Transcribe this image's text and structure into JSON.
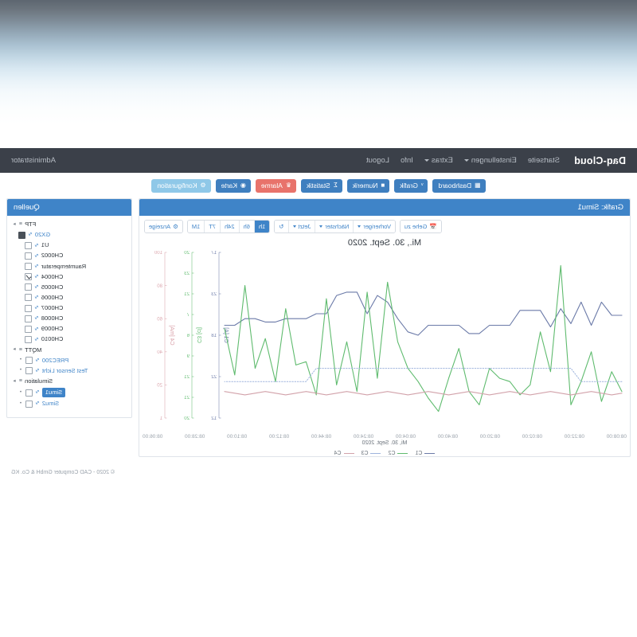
{
  "navbar": {
    "brand": "Daq-Cloud",
    "links": [
      {
        "label": "Startseite",
        "caret": false
      },
      {
        "label": "Einstellungen",
        "caret": true
      },
      {
        "label": "Extras",
        "caret": true
      },
      {
        "label": "Info",
        "caret": false
      },
      {
        "label": "Logout",
        "caret": false
      }
    ],
    "user": "Administrator"
  },
  "toolbar": {
    "buttons": [
      {
        "label": "Dashboard",
        "icon": "grid-icon",
        "glyph": "▦",
        "style": "primary"
      },
      {
        "label": "Grafik",
        "icon": "chart-icon",
        "glyph": "ᵛ",
        "style": "primary"
      },
      {
        "label": "Numerik",
        "icon": "table-icon",
        "glyph": "■",
        "style": "primary"
      },
      {
        "label": "Statistik",
        "icon": "sigma-icon",
        "glyph": "Σ",
        "style": "primary"
      },
      {
        "label": "Alarme",
        "icon": "bell-icon",
        "glyph": "♛",
        "style": "danger"
      },
      {
        "label": "Karte",
        "icon": "globe-icon",
        "glyph": "◉",
        "style": "primary"
      },
      {
        "label": "Konfiguration",
        "icon": "gear-icon",
        "glyph": "⚙",
        "style": "info"
      }
    ]
  },
  "panels": {
    "chart_title": "Grafik: Simu1",
    "sources_title": "Quellen"
  },
  "chart_toolbar": {
    "goto": "Gehe zu",
    "goto_icon": "calendar-icon",
    "prev": "Vorheriger",
    "next": "Nächster",
    "now": "Jetzt",
    "refresh_icon": "refresh-icon",
    "ranges": [
      {
        "label": "1h",
        "active": true
      },
      {
        "label": "6h",
        "active": false
      },
      {
        "label": "24h",
        "active": false
      },
      {
        "label": "7T",
        "active": false
      },
      {
        "label": "1M",
        "active": false
      }
    ],
    "display": "Anzeige",
    "display_icon": "gear-icon"
  },
  "chart_data": {
    "type": "line",
    "title": "Mi., 30. Sept. 2020",
    "xlabel": "Mi, 30. Sept. 2020",
    "grid": false,
    "legend_position": "bottom",
    "x": [
      "08:08:00",
      "08:22:00",
      "08:02:00",
      "08:20:00",
      "08:40:00",
      "08:04:00",
      "08:24:00",
      "08:44:00",
      "08:12:00",
      "08:10:00",
      "08:28:00",
      "08:06:00"
    ],
    "xticks": [
      "08:08:00",
      "08:22:00",
      "08:02:00",
      "08:20:00",
      "08:40:00",
      "08:04:00",
      "08:24:00",
      "08:44:00",
      "08:12:00",
      "08:10:00",
      "08:28:00",
      "08:06:00"
    ],
    "axes": [
      {
        "id": "y1",
        "label": "C1 [A]",
        "color": "#6b7aa8",
        "ticks": [
          "17",
          "23",
          "18",
          "22",
          "12"
        ],
        "ylim": [
          12,
          17
        ]
      },
      {
        "id": "y2",
        "label": "C3 [cl]",
        "color": "#5fbb6e",
        "ticks": [
          "20",
          "23",
          "21",
          "7",
          "6",
          "9",
          "21",
          "21",
          "20"
        ],
        "ylim": [
          20,
          20
        ]
      },
      {
        "id": "y3",
        "label": "C4 [mA]",
        "color": "#d9a0a8",
        "ticks": [
          "100",
          "80",
          "60",
          "40",
          "20",
          "1"
        ],
        "ylim": [
          1,
          100
        ]
      }
    ],
    "series": [
      {
        "name": "C1",
        "color": "#6b7aa8",
        "dash": "solid",
        "axis": "y1",
        "values": [
          62,
          62,
          70,
          56,
          70,
          57,
          66,
          55,
          65,
          65,
          65,
          56,
          56,
          56,
          51,
          51,
          56,
          56,
          56,
          56,
          50,
          52,
          60,
          70,
          74,
          63,
          76,
          76,
          74,
          63,
          63,
          60,
          60,
          60,
          58,
          58,
          60,
          60,
          56,
          56
        ]
      },
      {
        "name": "C2",
        "color": "#5fbb6e",
        "dash": "solid",
        "axis": "y2",
        "values": [
          16,
          28,
          10,
          40,
          22,
          8,
          92,
          28,
          52,
          20,
          14,
          22,
          24,
          30,
          8,
          16,
          42,
          24,
          4,
          12,
          22,
          30,
          46,
          82,
          24,
          76,
          16,
          46,
          20,
          72,
          14,
          34,
          32,
          66,
          22,
          48,
          30,
          80,
          26,
          54
        ]
      },
      {
        "name": "C3",
        "color": "#9fb4dd",
        "dash": "dotted",
        "axis": "y2",
        "values": [
          22,
          22,
          22,
          22,
          22,
          30,
          30,
          30,
          30,
          30,
          30,
          30,
          30,
          30,
          30,
          30,
          30,
          30,
          30,
          30,
          30,
          30,
          30,
          30,
          30,
          30,
          30,
          30,
          30,
          30,
          30,
          22,
          22,
          22,
          22,
          22,
          22,
          22,
          22,
          22
        ]
      },
      {
        "name": "C4",
        "color": "#d2a2aa",
        "dash": "solid",
        "axis": "y3",
        "values": [
          15,
          14,
          15,
          16,
          15,
          14,
          15,
          16,
          15,
          14,
          15,
          16,
          15,
          14,
          15,
          16,
          15,
          14,
          15,
          16,
          15,
          14,
          15,
          16,
          15,
          14,
          15,
          16,
          15,
          14,
          15,
          16,
          15,
          14,
          15,
          16,
          15,
          14,
          15,
          16
        ]
      }
    ],
    "legend": [
      {
        "name": "C1",
        "color": "#6b7aa8"
      },
      {
        "name": "C2",
        "color": "#5fbb6e"
      },
      {
        "name": "C3",
        "color": "#9fb4dd"
      },
      {
        "name": "C4",
        "color": "#d2a2aa"
      }
    ]
  },
  "sources": {
    "items": [
      {
        "label": "FTP",
        "level": 1,
        "expander": "▸",
        "icon": "folder-icon",
        "checkbox": "none",
        "style": "plain"
      },
      {
        "label": "GX20",
        "level": 2,
        "expander": "",
        "icon": "device-icon",
        "checkbox": "solid",
        "style": "blue"
      },
      {
        "label": "U1",
        "level": 3,
        "expander": "",
        "icon": "signal-icon",
        "checkbox": "empty",
        "style": "plain"
      },
      {
        "label": "CH0002",
        "level": 3,
        "expander": "",
        "icon": "signal-icon",
        "checkbox": "empty",
        "style": "plain"
      },
      {
        "label": "Raumtemperatur",
        "level": 3,
        "expander": "",
        "icon": "signal-icon",
        "checkbox": "empty",
        "style": "plain"
      },
      {
        "label": "CH0004",
        "level": 3,
        "expander": "",
        "icon": "signal-icon",
        "checkbox": "checked",
        "style": "plain"
      },
      {
        "label": "CH0005",
        "level": 3,
        "expander": "",
        "icon": "signal-icon",
        "checkbox": "empty",
        "style": "plain"
      },
      {
        "label": "CH0006",
        "level": 3,
        "expander": "",
        "icon": "signal-icon",
        "checkbox": "empty",
        "style": "plain"
      },
      {
        "label": "CH0007",
        "level": 3,
        "expander": "",
        "icon": "signal-icon",
        "checkbox": "empty",
        "style": "plain"
      },
      {
        "label": "CH0008",
        "level": 3,
        "expander": "",
        "icon": "signal-icon",
        "checkbox": "empty",
        "style": "plain"
      },
      {
        "label": "CH0009",
        "level": 3,
        "expander": "",
        "icon": "signal-icon",
        "checkbox": "empty",
        "style": "plain"
      },
      {
        "label": "CH0010",
        "level": 3,
        "expander": "",
        "icon": "signal-icon",
        "checkbox": "empty",
        "style": "plain"
      },
      {
        "label": "MQTT",
        "level": 1,
        "expander": "▸",
        "icon": "folder-icon",
        "checkbox": "none",
        "style": "plain"
      },
      {
        "label": "PREC200",
        "level": 2,
        "expander": "•",
        "icon": "signal-icon",
        "checkbox": "empty",
        "style": "blue"
      },
      {
        "label": "Test Sensor Licht",
        "level": 2,
        "expander": "•",
        "icon": "signal-icon",
        "checkbox": "empty",
        "style": "blue"
      },
      {
        "label": "Simulation",
        "level": 1,
        "expander": "▸",
        "icon": "folder-icon",
        "checkbox": "none",
        "style": "plain"
      },
      {
        "label": "Simu1",
        "level": 2,
        "expander": "•",
        "icon": "signal-icon",
        "checkbox": "empty",
        "style": "selected"
      },
      {
        "label": "Simu2",
        "level": 2,
        "expander": "•",
        "icon": "signal-icon",
        "checkbox": "empty",
        "style": "blue"
      }
    ]
  },
  "footer": {
    "copyright": "© 2020 - CAD Computer GmbH & Co. KG"
  }
}
